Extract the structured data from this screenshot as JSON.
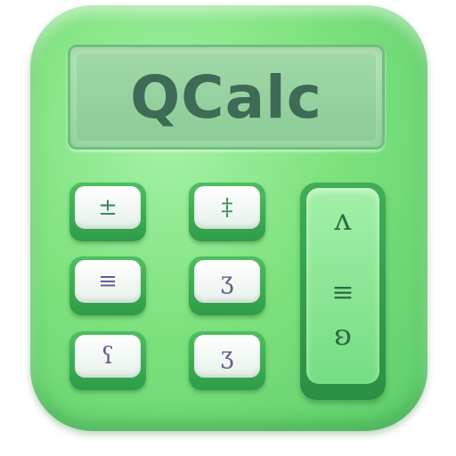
{
  "app": {
    "screen_text": "QCalc"
  },
  "keys": [
    {
      "glyph": "±",
      "color": "green"
    },
    {
      "glyph": "‡",
      "color": "green"
    },
    {
      "glyph": "≡",
      "color": "purple"
    },
    {
      "glyph": "ʒ",
      "color": "purple"
    },
    {
      "glyph": "ʕ",
      "color": "purple"
    },
    {
      "glyph": "ʒ",
      "color": "purple"
    }
  ],
  "tall_key": {
    "top_glyph": "ʌ",
    "mid_glyph": "≡",
    "bottom_glyph": "ʚ"
  },
  "colors": {
    "body": "#7ee27e",
    "screen": "#9fd9a8",
    "screen_text": "#3d6b55",
    "key_base": "#2f9c48"
  }
}
